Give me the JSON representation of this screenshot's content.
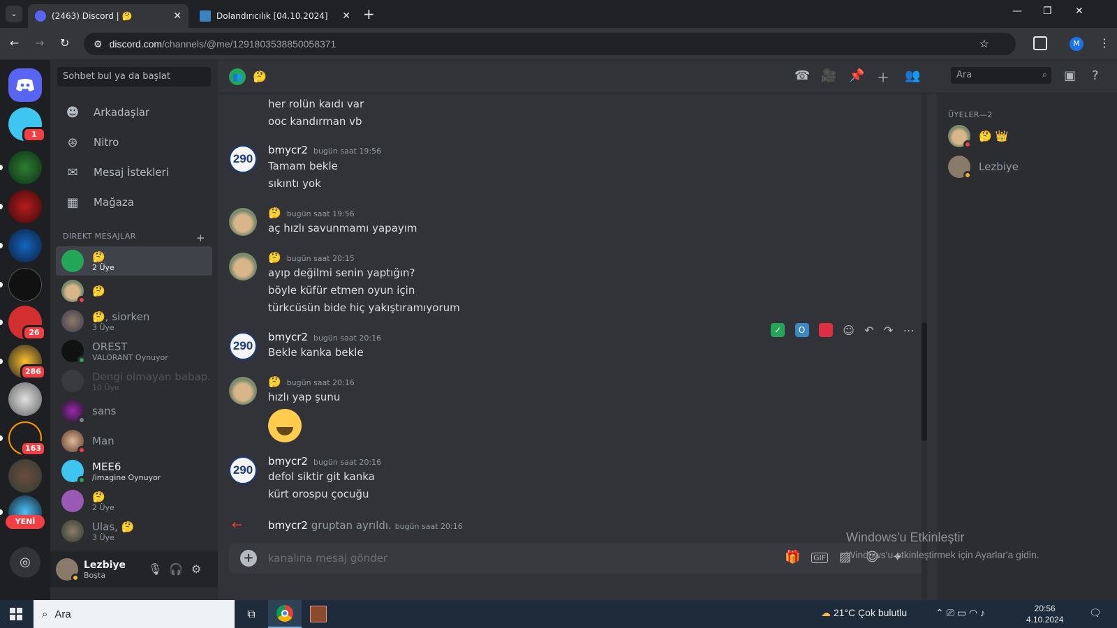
{
  "browser": {
    "tabs": [
      {
        "title": "(2463) Discord | 🤔",
        "active": true
      },
      {
        "title": "Dolandırıcılık [04.10.2024]",
        "active": false
      }
    ],
    "url_host": "discord.com",
    "url_path": "/channels/@me/1291803538850058371",
    "profile_letter": "M"
  },
  "guilds": {
    "badges": [
      "1",
      "26",
      "286",
      "163"
    ],
    "yeni_label": "YENİ"
  },
  "dm": {
    "search_placeholder": "Sohbet bul ya da başlat",
    "nav": [
      {
        "label": "Arkadaşlar",
        "icon": "friends-icon"
      },
      {
        "label": "Nitro",
        "icon": "nitro-icon"
      },
      {
        "label": "Mesaj İstekleri",
        "icon": "mail-icon"
      },
      {
        "label": "Mağaza",
        "icon": "shop-icon"
      }
    ],
    "header": "DİREKT MESAJLAR",
    "items": [
      {
        "name": "🤔",
        "sub": "2 Üye"
      },
      {
        "name": "🤔",
        "sub": ""
      },
      {
        "name": "🤔, siorken",
        "sub": "3 Üye"
      },
      {
        "name": "OREST",
        "sub": "VALORANT Oynuyor"
      },
      {
        "name": "Dengi olmayan babap...",
        "sub": "10 Üye"
      },
      {
        "name": "sans",
        "sub": ""
      },
      {
        "name": "Man",
        "sub": ""
      },
      {
        "name": "MEE6",
        "sub": "/imagine Oynuyor"
      },
      {
        "name": "🤔",
        "sub": "2 Üye"
      },
      {
        "name": "Ulas, 🤔",
        "sub": "3 Üye"
      }
    ],
    "user": {
      "name": "Lezbiye",
      "status": "Boşta"
    }
  },
  "chat": {
    "header_name": "🤔",
    "search_placeholder": "Ara",
    "messages": [
      {
        "lines": [
          "her rolün kaıdı var",
          "ooc kandırman vb"
        ]
      },
      {
        "author": "bmycr2",
        "time": "bugün saat 19:56",
        "lines": [
          "Tamam bekle",
          "sıkıntı yok"
        ]
      },
      {
        "author": "🤔",
        "time": "bugün saat 19:56",
        "lines": [
          "aç hızlı savunmamı yapayım"
        ]
      },
      {
        "author": "🤔",
        "time": "bugün saat 20:15",
        "lines": [
          "ayıp değilmi senin yaptığın?",
          "böyle küfür etmen oyun için",
          "türkcüsün bide hiç yakıştıramıyorum"
        ]
      },
      {
        "author": "bmycr2",
        "time": "bugün saat 20:16",
        "lines": [
          "Bekle kanka bekle"
        ]
      },
      {
        "author": "🤔",
        "time": "bugün saat 20:16",
        "lines": [
          "hızlı yap şunu"
        ]
      },
      {
        "author": "bmycr2",
        "time": "bugün saat 20:16",
        "lines": [
          "defol siktir git kanka",
          "kürt orospu çocuğu"
        ]
      }
    ],
    "system": {
      "name": "bmycr2",
      "text": "gruptan ayrıldı.",
      "time": "bugün saat 20:16"
    },
    "avatar_label": "290",
    "composer_placeholder": "kanalına mesaj gönder"
  },
  "members": {
    "header": "ÜYELER—2",
    "list": [
      {
        "name": "🤔 👑"
      },
      {
        "name": "Lezbiye"
      }
    ]
  },
  "watermark": {
    "line1": "Windows'u Etkinleştir",
    "line2": "Windows'u etkinleştirmek için Ayarlar'a gidin."
  },
  "taskbar": {
    "search": "Ara",
    "weather": "21°C  Çok bulutlu",
    "time": "20:56",
    "date": "4.10.2024"
  }
}
